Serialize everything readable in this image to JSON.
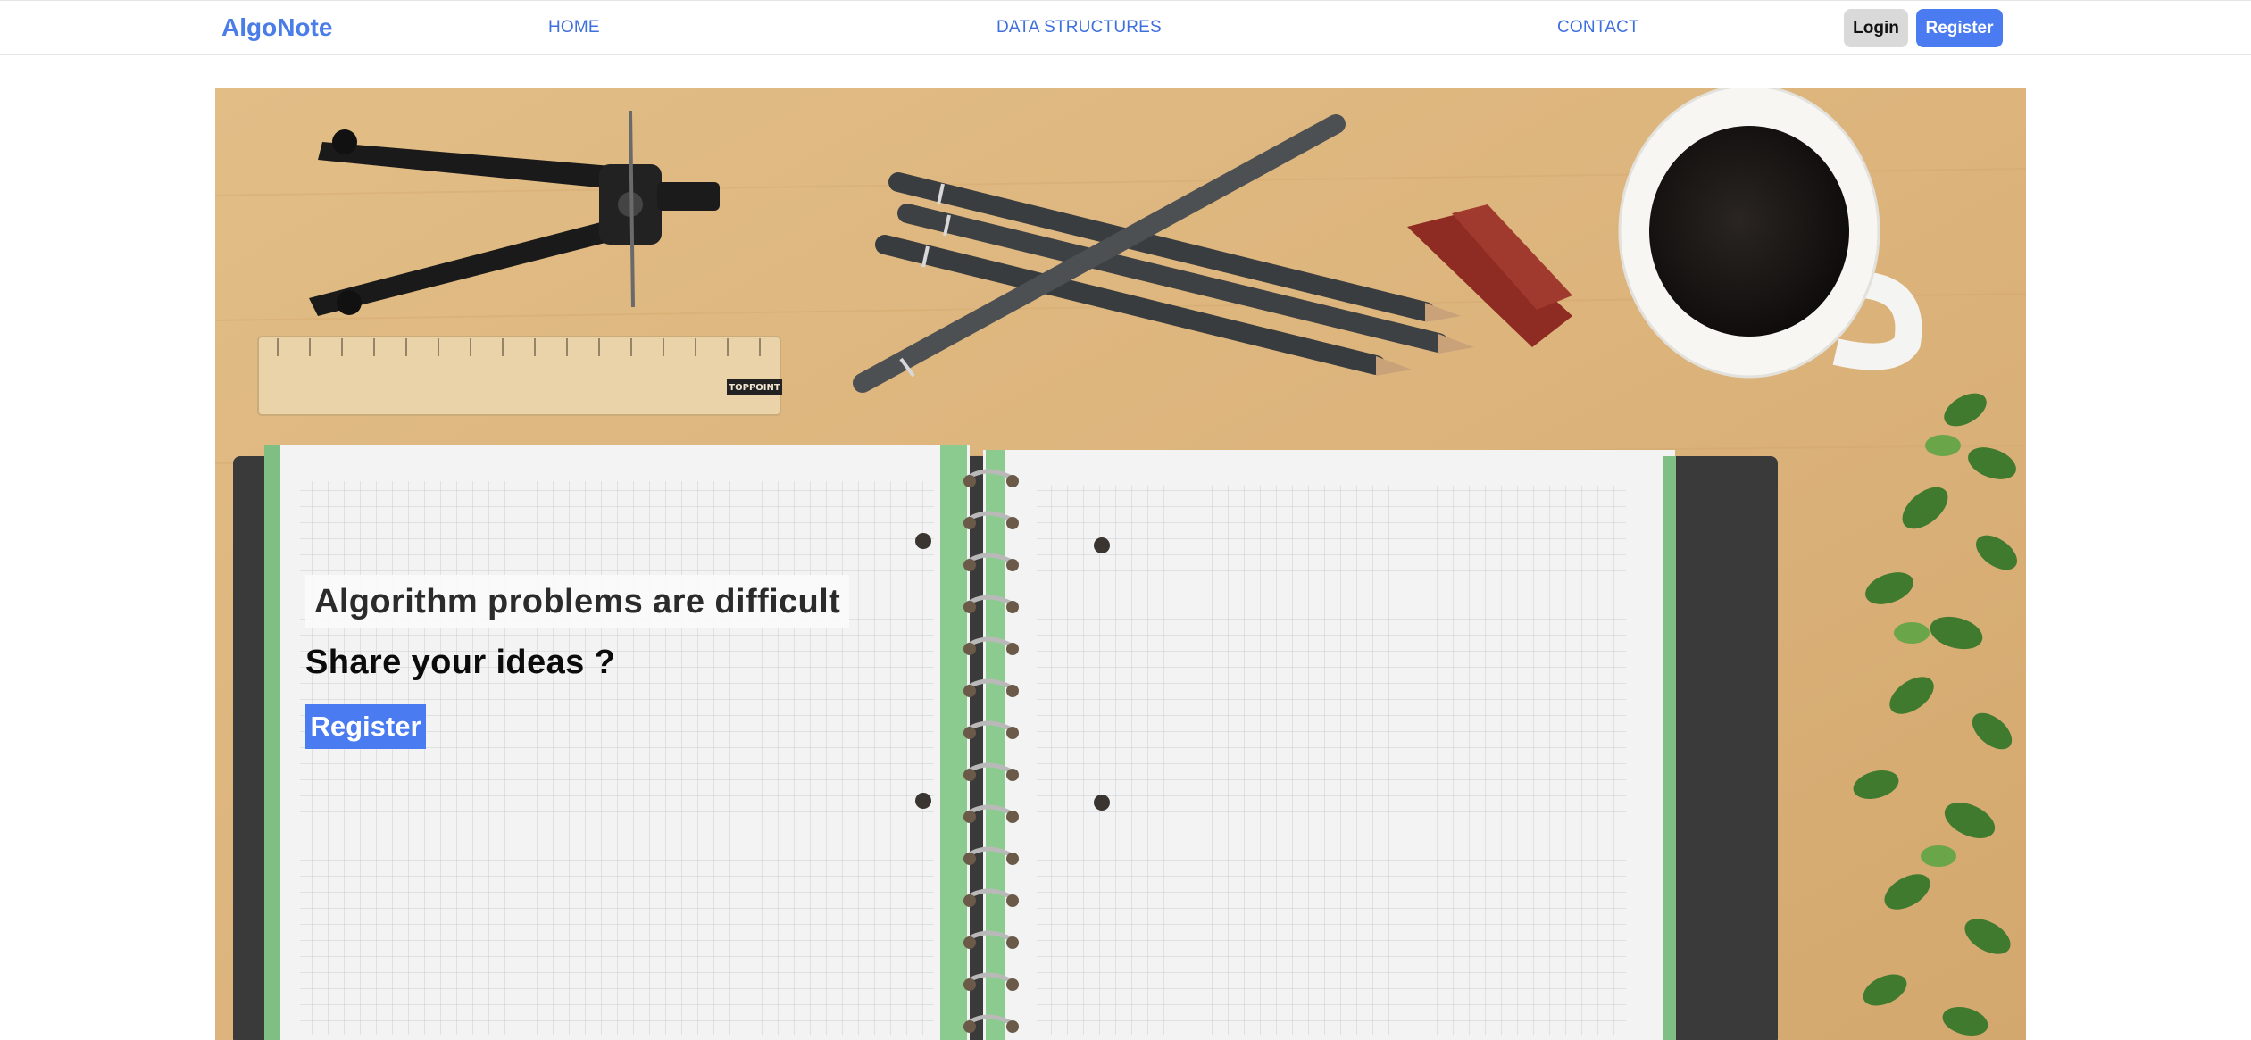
{
  "navbar": {
    "brand": "AlgoNote",
    "links": [
      {
        "label": "HOME"
      },
      {
        "label": "DATA STRUCTURES"
      },
      {
        "label": "CONTACT"
      }
    ],
    "login_label": "Login",
    "register_label": "Register"
  },
  "hero": {
    "title": "Algorithm problems are difficult",
    "subtitle": "Share your ideas ?",
    "cta_label": "Register",
    "ruler_brand": "TOPPOINT"
  },
  "colors": {
    "brand": "#4a7de8",
    "link": "#3e6fde",
    "primary_button": "#4a7bf0",
    "login_button": "#d9d9d9",
    "desk": "#dcb37a"
  }
}
